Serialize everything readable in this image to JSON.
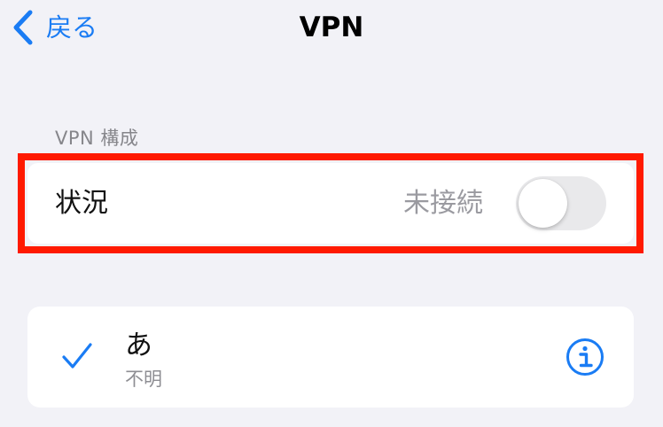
{
  "nav": {
    "back_label": "戻る",
    "title": "VPN"
  },
  "section": {
    "header": "VPN 構成"
  },
  "status_row": {
    "label": "状況",
    "value": "未接続",
    "toggle_on": false
  },
  "config": {
    "name": "あ",
    "subtitle": "不明",
    "selected": true
  },
  "colors": {
    "accent": "#1a7cf4",
    "background": "#f2f2f7",
    "highlight": "#ff1a00"
  },
  "icons": {
    "back": "chevron-left-icon",
    "selected": "checkmark-icon",
    "info": "info-circle-icon"
  }
}
